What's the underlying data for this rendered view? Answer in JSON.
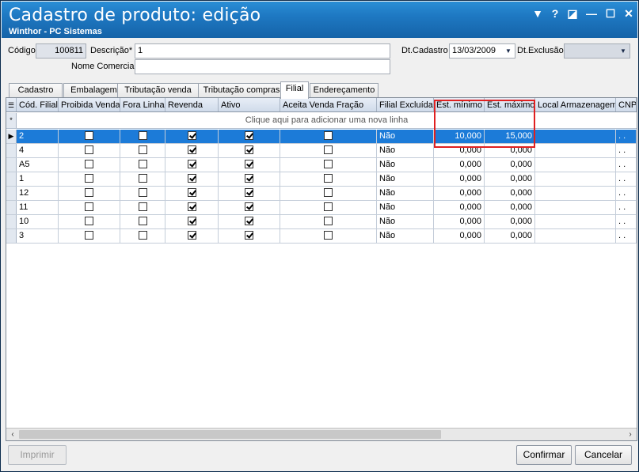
{
  "window": {
    "title": "Cadastro de produto: edição",
    "subtitle": "Winthor - PC Sistemas",
    "controls": [
      "▼",
      "?",
      "◪",
      "—",
      "☐",
      "✕"
    ]
  },
  "form": {
    "codigo_label": "Código",
    "codigo_value": "100811",
    "descricao_label": "Descrição*",
    "descricao_value": "1",
    "nome_comercial_label": "Nome Comercial",
    "nome_comercial_value": "",
    "dt_cadastro_label": "Dt.Cadastro",
    "dt_cadastro_value": "13/03/2009",
    "dt_exclusao_label": "Dt.Exclusão",
    "dt_exclusao_value": ""
  },
  "tabs": [
    {
      "label": "Cadastro"
    },
    {
      "label": "Embalagem"
    },
    {
      "label": "Tributação venda"
    },
    {
      "label": "Tributação compras"
    },
    {
      "label": "Filial"
    },
    {
      "label": "Endereçamento"
    }
  ],
  "active_tab": "Filial",
  "grid": {
    "columns": [
      "Cód. Filial",
      "Proibida Venda",
      "Fora Linha",
      "Revenda",
      "Ativo",
      "Aceita Venda Fração",
      "Filial Excluída",
      "Est. mínimo",
      "Est. máximo",
      "Local Armazenagem",
      "CNPJ"
    ],
    "add_row_text": "Clique aqui para adicionar uma nova linha",
    "add_row_marker": "*",
    "rows": [
      {
        "cod": "2",
        "proibida": false,
        "fora_linha": false,
        "revenda": true,
        "ativo": true,
        "fracao": false,
        "excluida": "Não",
        "min": "10,000",
        "max": "15,000",
        "extra": ". ."
      },
      {
        "cod": "4",
        "proibida": false,
        "fora_linha": false,
        "revenda": true,
        "ativo": true,
        "fracao": false,
        "excluida": "Não",
        "min": "0,000",
        "max": "0,000",
        "extra": ". ."
      },
      {
        "cod": "A5",
        "proibida": false,
        "fora_linha": false,
        "revenda": true,
        "ativo": true,
        "fracao": false,
        "excluida": "Não",
        "min": "0,000",
        "max": "0,000",
        "extra": ". ."
      },
      {
        "cod": "1",
        "proibida": false,
        "fora_linha": false,
        "revenda": true,
        "ativo": true,
        "fracao": false,
        "excluida": "Não",
        "min": "0,000",
        "max": "0,000",
        "extra": ". ."
      },
      {
        "cod": "12",
        "proibida": false,
        "fora_linha": false,
        "revenda": true,
        "ativo": true,
        "fracao": false,
        "excluida": "Não",
        "min": "0,000",
        "max": "0,000",
        "extra": ". ."
      },
      {
        "cod": "11",
        "proibida": false,
        "fora_linha": false,
        "revenda": true,
        "ativo": true,
        "fracao": false,
        "excluida": "Não",
        "min": "0,000",
        "max": "0,000",
        "extra": ". ."
      },
      {
        "cod": "10",
        "proibida": false,
        "fora_linha": false,
        "revenda": true,
        "ativo": true,
        "fracao": false,
        "excluida": "Não",
        "min": "0,000",
        "max": "0,000",
        "extra": ". ."
      },
      {
        "cod": "3",
        "proibida": false,
        "fora_linha": false,
        "revenda": true,
        "ativo": true,
        "fracao": false,
        "excluida": "Não",
        "min": "0,000",
        "max": "0,000",
        "extra": ". ."
      }
    ]
  },
  "buttons": {
    "imprimir": "Imprimir",
    "confirmar": "Confirmar",
    "cancelar": "Cancelar"
  },
  "colors": {
    "title_bar": "#1e78c2",
    "selected_row": "#1c7bd8",
    "highlight_box": "#e02020"
  }
}
